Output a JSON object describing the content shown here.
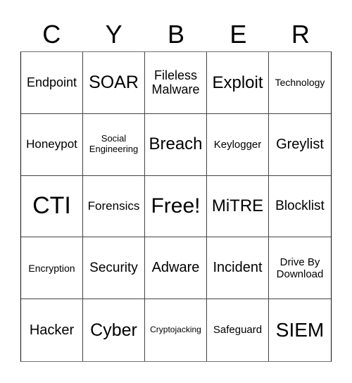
{
  "header": {
    "letters": [
      "C",
      "Y",
      "B",
      "E",
      "R"
    ]
  },
  "board": {
    "rows": [
      [
        "Endpoint",
        "SOAR",
        "Fileless Malware",
        "Exploit",
        "Technology"
      ],
      [
        "Honeypot",
        "Social Engineering",
        "Breach",
        "Keylogger",
        "Greylist"
      ],
      [
        "CTI",
        "Forensics",
        "Free!",
        "MiTRE",
        "Blocklist"
      ],
      [
        "Encryption",
        "Security",
        "Adware",
        "Incident",
        "Drive By Download"
      ],
      [
        "Hacker",
        "Cyber",
        "Cryptojacking",
        "Safeguard",
        "SIEM"
      ]
    ],
    "free_space": "Free!"
  }
}
